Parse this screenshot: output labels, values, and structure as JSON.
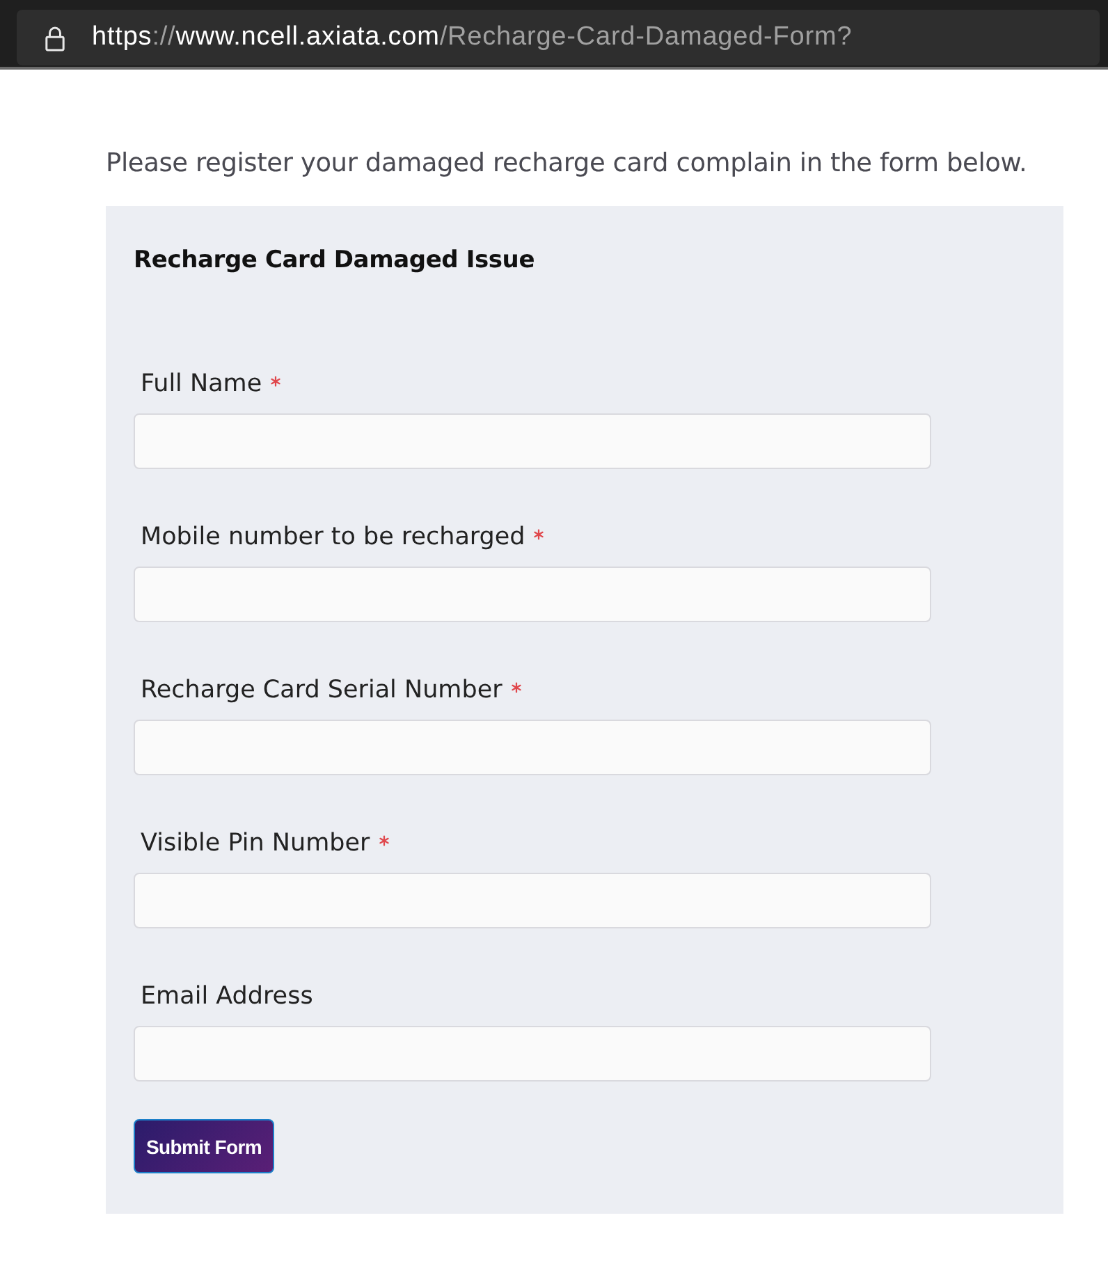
{
  "browser": {
    "url": {
      "scheme": "https",
      "separator": "://",
      "host": "www.ncell.axiata.com",
      "path": "/Recharge-Card-Damaged-Form?"
    }
  },
  "intro": "Please register your damaged recharge card complain in the form below.",
  "form": {
    "title": "Recharge Card Damaged Issue",
    "fields": [
      {
        "label": "Full Name",
        "required": true
      },
      {
        "label": "Mobile number to be recharged",
        "required": true
      },
      {
        "label": "Recharge Card Serial Number",
        "required": true
      },
      {
        "label": "Visible Pin Number",
        "required": true
      },
      {
        "label": "Email Address",
        "required": false
      }
    ],
    "submit": "Submit Form"
  }
}
